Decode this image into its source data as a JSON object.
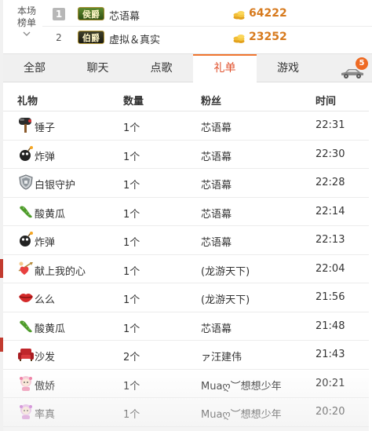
{
  "ranking": {
    "label_line1": "本场",
    "label_line2": "榜单",
    "rows": [
      {
        "rank": "1",
        "badge": "侯爵",
        "name": "芯语幕",
        "score": "64222"
      },
      {
        "rank": "2",
        "badge": "伯爵",
        "name": "虚拟＆真实",
        "score": "23252"
      }
    ]
  },
  "tabs": [
    {
      "label": "全部"
    },
    {
      "label": "聊天"
    },
    {
      "label": "点歌"
    },
    {
      "label": "礼单"
    },
    {
      "label": "游戏"
    }
  ],
  "car_badge_count": "5",
  "gift_table": {
    "headers": {
      "gift": "礼物",
      "qty": "数量",
      "fan": "粉丝",
      "time": "时间"
    },
    "rows": [
      {
        "icon": "hammer-icon",
        "gift": "锤子",
        "qty": "1个",
        "fan": "芯语幕",
        "time": "22:31"
      },
      {
        "icon": "bomb-icon",
        "gift": "炸弹",
        "qty": "1个",
        "fan": "芯语幕",
        "time": "22:30"
      },
      {
        "icon": "silver-shield-icon",
        "gift": "白银守护",
        "qty": "1个",
        "fan": "芯语幕",
        "time": "22:28"
      },
      {
        "icon": "cucumber-icon",
        "gift": "酸黄瓜",
        "qty": "1个",
        "fan": "芯语幕",
        "time": "22:14"
      },
      {
        "icon": "bomb-icon",
        "gift": "炸弹",
        "qty": "1个",
        "fan": "芯语幕",
        "time": "22:13"
      },
      {
        "icon": "cupid-heart-icon",
        "gift": "献上我的心",
        "qty": "1个",
        "fan": "(龙游天下)",
        "time": "22:04"
      },
      {
        "icon": "lips-icon",
        "gift": "么么",
        "qty": "1个",
        "fan": "(龙游天下)",
        "time": "21:56"
      },
      {
        "icon": "cucumber-icon",
        "gift": "酸黄瓜",
        "qty": "1个",
        "fan": "芯语幕",
        "time": "21:48"
      },
      {
        "icon": "sofa-icon",
        "gift": "沙发",
        "qty": "2个",
        "fan": "ァ汪建伟",
        "time": "21:43"
      },
      {
        "icon": "proud-girl-icon",
        "gift": "傲娇",
        "qty": "1个",
        "fan": "Muaღ︶想想少年",
        "time": "20:21"
      },
      {
        "icon": "honest-girl-icon",
        "gift": "率真",
        "qty": "1个",
        "fan": "Muaღ︶想想少年",
        "time": "20:20"
      }
    ]
  },
  "colors": {
    "accent": "#e0512d",
    "score": "#d77a1d",
    "badge": "#ee6a23"
  }
}
